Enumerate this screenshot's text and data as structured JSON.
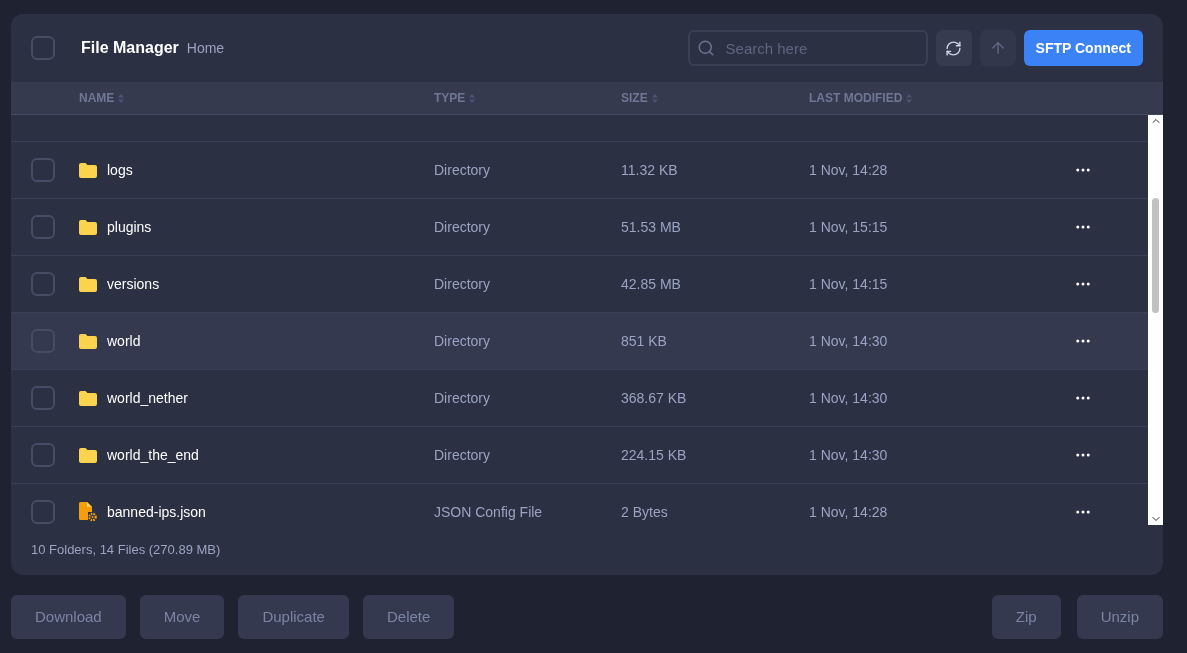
{
  "header": {
    "select_all_checked": false,
    "title": "File Manager",
    "breadcrumb": "Home",
    "search": {
      "placeholder": "Search here"
    },
    "connect_button": "SFTP Connect"
  },
  "table": {
    "columns": [
      "NAME",
      "TYPE",
      "SIZE",
      "LAST MODIFIED"
    ],
    "rows": [
      {
        "kind": "folder",
        "name": "logs",
        "type": "Directory",
        "size": "11.32 KB",
        "modified": "1 Nov, 14:28",
        "hovered": false,
        "checked": false
      },
      {
        "kind": "folder",
        "name": "plugins",
        "type": "Directory",
        "size": "51.53 MB",
        "modified": "1 Nov, 15:15",
        "hovered": false,
        "checked": false
      },
      {
        "kind": "folder",
        "name": "versions",
        "type": "Directory",
        "size": "42.85 MB",
        "modified": "1 Nov, 14:15",
        "hovered": false,
        "checked": false
      },
      {
        "kind": "folder",
        "name": "world",
        "type": "Directory",
        "size": "851 KB",
        "modified": "1 Nov, 14:30",
        "hovered": true,
        "checked": false
      },
      {
        "kind": "folder",
        "name": "world_nether",
        "type": "Directory",
        "size": "368.67 KB",
        "modified": "1 Nov, 14:30",
        "hovered": false,
        "checked": false
      },
      {
        "kind": "folder",
        "name": "world_the_end",
        "type": "Directory",
        "size": "224.15 KB",
        "modified": "1 Nov, 14:30",
        "hovered": false,
        "checked": false
      },
      {
        "kind": "config",
        "name": "banned-ips.json",
        "type": "JSON Config File",
        "size": "2 Bytes",
        "modified": "1 Nov, 14:28",
        "hovered": false,
        "checked": false
      }
    ]
  },
  "summary": "10 Folders, 14 Files (270.89 MB)",
  "actions_left": [
    "Download",
    "Move",
    "Duplicate",
    "Delete"
  ],
  "actions_right": [
    "Zip",
    "Unzip"
  ]
}
